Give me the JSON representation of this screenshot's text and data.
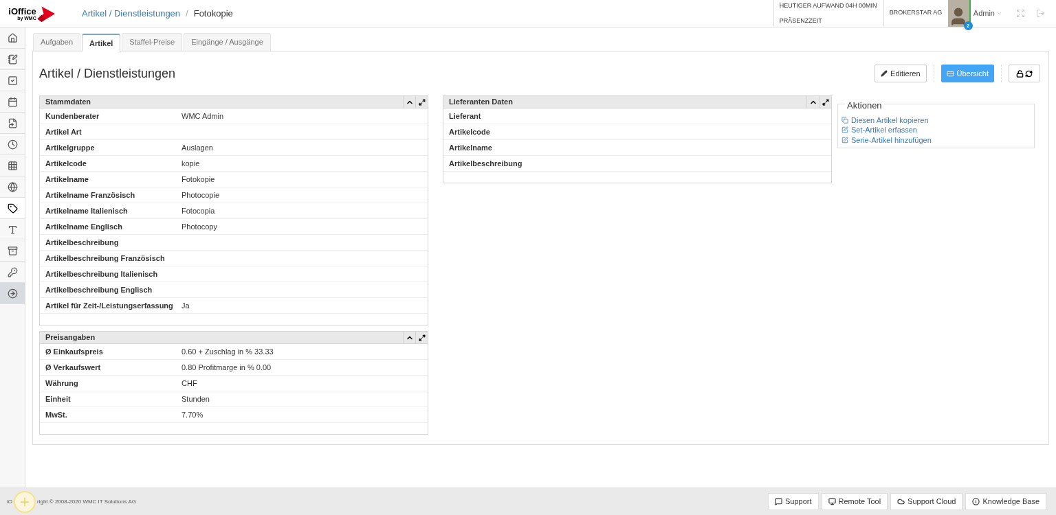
{
  "logo": {
    "name": "iOffice",
    "sub": "by WMC"
  },
  "breadcrumb": {
    "parent": "Artikel / Dienstleistungen",
    "separator": "/",
    "current": "Fotokopie"
  },
  "header": {
    "effort": "HEUTIGER AUFWAND 04H 00MIN",
    "presence": "PRÄSENZZEIT",
    "company": "BROKERSTAR AG",
    "user": "Admin",
    "badge": "2"
  },
  "sidebar": [
    {
      "kind": "nav",
      "selected": false
    },
    {
      "kind": "nav",
      "selected": false
    },
    {
      "kind": "nav",
      "selected": false
    },
    {
      "kind": "nav",
      "selected": false
    },
    {
      "kind": "nav",
      "selected": false
    },
    {
      "kind": "nav",
      "selected": false
    },
    {
      "kind": "nav",
      "selected": false
    },
    {
      "kind": "nav",
      "selected": false
    },
    {
      "kind": "nav",
      "selected": true
    },
    {
      "kind": "nav",
      "selected": false
    },
    {
      "kind": "nav",
      "selected": false
    },
    {
      "kind": "nav",
      "selected": false
    },
    {
      "kind": "toggle",
      "selected": false
    }
  ],
  "tabs": [
    {
      "label": "Aufgaben",
      "selected": false
    },
    {
      "label": "Artikel",
      "selected": true
    },
    {
      "label": "Staffel-Preise",
      "selected": false
    },
    {
      "label": "Eingänge / Ausgänge",
      "selected": false
    }
  ],
  "page_title": "Artikel / Dienstleistungen",
  "buttons": {
    "edit": "Editieren",
    "overview": "Übersicht"
  },
  "panels": [
    {
      "title": "Stammdaten",
      "rows": [
        {
          "label": "Kundenberater",
          "value": "WMC Admin"
        },
        {
          "label": "Artikel Art"
        },
        {
          "label": "Artikelgruppe",
          "value": "Auslagen"
        },
        {
          "label": "Artikelcode",
          "value": "kopie"
        },
        {
          "label": "Artikelname",
          "value": "Fotokopie"
        },
        {
          "label": "Artikelname Französisch",
          "value": "Photocopie"
        },
        {
          "label": "Artikelname Italienisch",
          "value": "Fotocopia"
        },
        {
          "label": "Artikelname Englisch",
          "value": "Photocopy"
        },
        {
          "label": "Artikelbeschreibung"
        },
        {
          "label": "Artikelbeschreibung Französisch"
        },
        {
          "label": "Artikelbeschreibung Italienisch"
        },
        {
          "label": "Artikelbeschreibung Englisch"
        },
        {
          "label": "Artikel für Zeit-/Leistungserfassung",
          "value": "Ja"
        }
      ]
    },
    {
      "title": "Preisangaben",
      "rows": [
        {
          "label": "Ø Einkaufspreis",
          "value": "0.60 + Zuschlag in % 33.33"
        },
        {
          "label": "Ø Verkaufswert",
          "value": "0.80 Profitmarge in % 0.00"
        },
        {
          "label": "Währung",
          "value": "CHF"
        },
        {
          "label": "Einheit",
          "value": "Stunden"
        },
        {
          "label": "MwSt.",
          "value": "7.70%"
        }
      ]
    },
    {
      "title": "Lieferanten Daten",
      "rows": [
        {
          "label": "Lieferant"
        },
        {
          "label": "Artikelcode"
        },
        {
          "label": "Artikelname"
        },
        {
          "label": "Artikelbeschreibung"
        }
      ]
    }
  ],
  "actions": {
    "title": "Aktionen",
    "items": [
      {
        "kind": "copy",
        "label": "Diesen Artikel kopieren"
      },
      {
        "kind": "edit",
        "label": "Set-Artikel erfassen"
      },
      {
        "kind": "edit",
        "label": "Serie-Artikel hinzufügen"
      }
    ]
  },
  "footer": {
    "copyright_start": "iO",
    "copyright_end": "right © 2008-2020 WMC IT Solutions AG",
    "buttons": [
      {
        "kind": "chat",
        "label": "Support"
      },
      {
        "kind": "monitor",
        "label": "Remote Tool"
      },
      {
        "kind": "cloud",
        "label": "Support Cloud"
      },
      {
        "kind": "info",
        "label": "Knowledge Base"
      }
    ]
  }
}
